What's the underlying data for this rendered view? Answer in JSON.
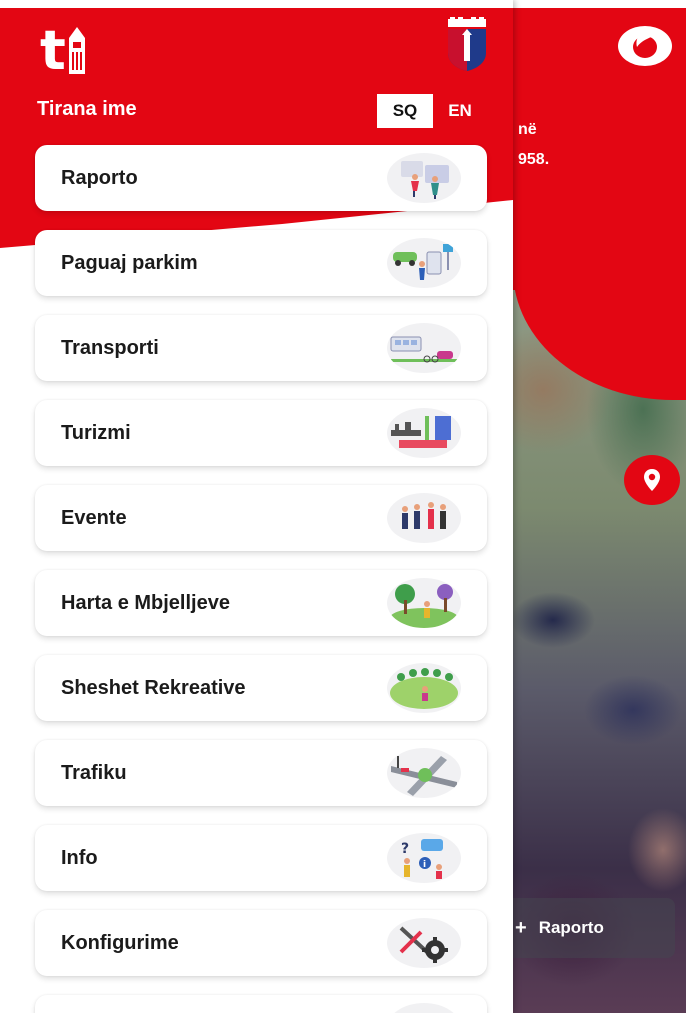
{
  "app": {
    "title": "Tirana ime",
    "logo_text": "t"
  },
  "language": {
    "options": [
      "SQ",
      "EN"
    ],
    "selected": "SQ"
  },
  "menu": [
    {
      "label": "Raporto",
      "icon": "report-illustration"
    },
    {
      "label": "Paguaj parkim",
      "icon": "parking-illustration"
    },
    {
      "label": "Transporti",
      "icon": "transport-illustration"
    },
    {
      "label": "Turizmi",
      "icon": "tourism-illustration"
    },
    {
      "label": "Evente",
      "icon": "events-illustration"
    },
    {
      "label": "Harta e Mbjelljeve",
      "icon": "planting-map-illustration"
    },
    {
      "label": "Sheshet Rekreative",
      "icon": "recreation-illustration"
    },
    {
      "label": "Trafiku",
      "icon": "traffic-illustration"
    },
    {
      "label": "Info",
      "icon": "info-illustration"
    },
    {
      "label": "Konfigurime",
      "icon": "settings-illustration"
    }
  ],
  "background": {
    "text_line1": "në",
    "text_line2": "958.",
    "report_button": "Raporto",
    "report_plus": "+"
  },
  "colors": {
    "brand_red": "#e30613",
    "white": "#ffffff"
  }
}
